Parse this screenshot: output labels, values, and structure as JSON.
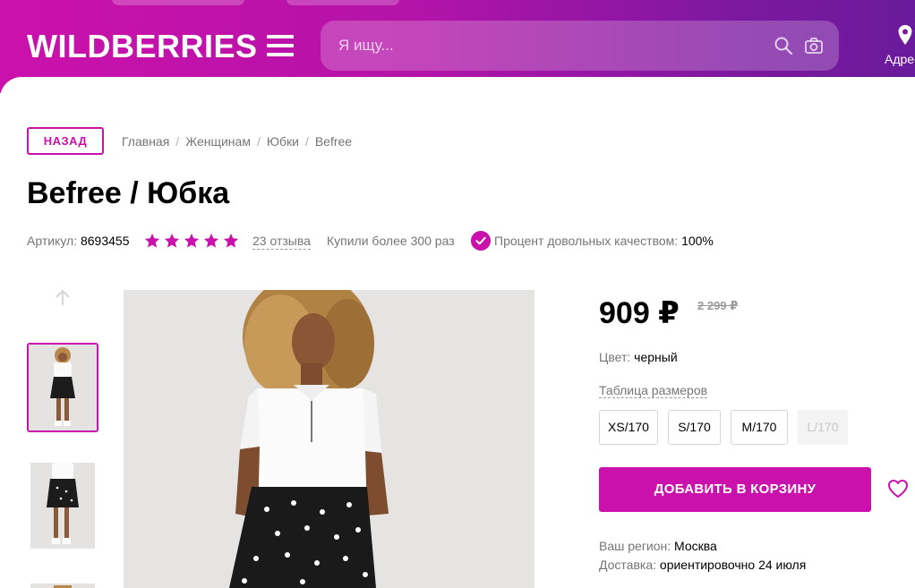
{
  "header": {
    "logo": "WILDBERRIES",
    "search_placeholder": "Я ищу...",
    "address_label": "Адрес",
    "colors": {
      "brand": "#cb11ab",
      "gradient_end": "#6a1a9c"
    }
  },
  "breadcrumb": {
    "back_label": "НАЗАД",
    "items": [
      "Главная",
      "Женщинам",
      "Юбки",
      "Befree"
    ],
    "separator": "/"
  },
  "product": {
    "title": "Befree / Юбка",
    "article_label": "Артикул:",
    "article_value": "8693455",
    "rating_stars": 5,
    "reviews_label": "23 отзыва",
    "bought_label": "Купили более 300 раз",
    "quality_label": "Процент довольных качеством:",
    "quality_value": "100%"
  },
  "gallery": {
    "thumbnail_count_visible": 3,
    "active_thumbnail": 1,
    "main_photo": "model-photo"
  },
  "purchase": {
    "price": "909 ₽",
    "old_price": "2 299 ₽",
    "color_label": "Цвет:",
    "color_value": "черный",
    "size_table_label": "Таблица размеров",
    "sizes": [
      {
        "label": "XS/170",
        "available": true
      },
      {
        "label": "S/170",
        "available": true
      },
      {
        "label": "M/170",
        "available": true
      },
      {
        "label": "L/170",
        "available": false
      }
    ],
    "add_to_cart_label": "ДОБАВИТЬ В КОРЗИНУ",
    "region_label": "Ваш регион:",
    "region_value": "Москва",
    "delivery_label": "Доставка:",
    "delivery_value": "ориентировочно 24 июля"
  }
}
